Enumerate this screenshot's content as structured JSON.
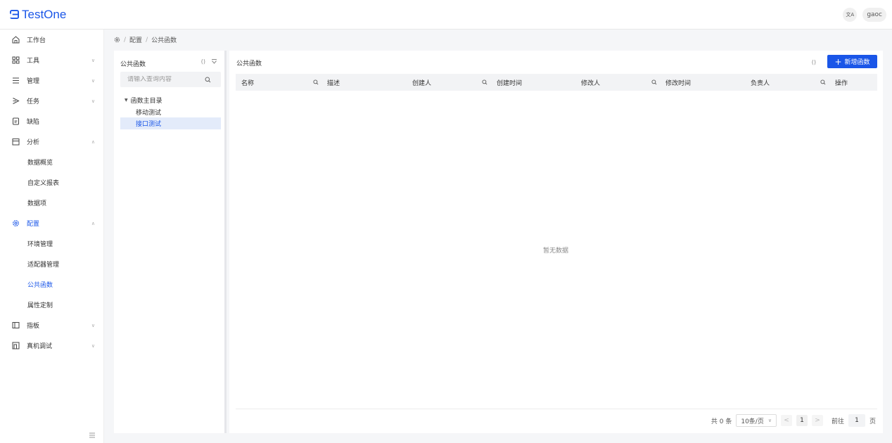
{
  "app": {
    "name": "TestOne",
    "brand_color": "#1a56e8"
  },
  "topbar": {
    "lang_icon": "translate-icon",
    "lang_label": "文A",
    "user": "gaoc"
  },
  "sidebar": {
    "items": [
      {
        "label": "工作台",
        "icon": "home-icon"
      },
      {
        "label": "工具",
        "icon": "grid-icon",
        "arrow": "∨"
      },
      {
        "label": "管理",
        "icon": "list-icon",
        "arrow": "∨"
      },
      {
        "label": "任务",
        "icon": "play-icon",
        "arrow": "∨"
      },
      {
        "label": "缺陷",
        "icon": "doc-icon"
      },
      {
        "label": "分析",
        "icon": "calendar-icon",
        "arrow": "∧"
      },
      {
        "label": "数据概览"
      },
      {
        "label": "自定义报表"
      },
      {
        "label": "数据项"
      },
      {
        "label": "配置",
        "icon": "gear-icon",
        "arrow": "∧"
      },
      {
        "label": "环境管理"
      },
      {
        "label": "适配器管理"
      },
      {
        "label": "公共函数"
      },
      {
        "label": "属性定制"
      },
      {
        "label": "指板",
        "icon": "board-icon",
        "arrow": "∨"
      },
      {
        "label": "真机调试",
        "icon": "device-icon",
        "arrow": "∨"
      }
    ]
  },
  "breadcrumb": {
    "home_icon": "settings-icon",
    "items": [
      "配置",
      "公共函数"
    ],
    "separator": "/"
  },
  "tree": {
    "title": "公共函数",
    "refresh_icon": "()",
    "search_placeholder": "请输入查询内容",
    "root": "函数主目录",
    "nodes": [
      "移动测试",
      "接口测试"
    ],
    "selected": "接口测试"
  },
  "main": {
    "title": "公共函数",
    "refresh_icon": "()",
    "add_button": "新增函数",
    "columns": [
      "名称",
      "描述",
      "创建人",
      "创建时间",
      "修改人",
      "修改时间",
      "负责人",
      "操作"
    ],
    "empty_text": "暂无数据"
  },
  "pager": {
    "total_text": "共 0 条",
    "page_size": "10条/页",
    "prev": "<",
    "current_page": "1",
    "next": ">",
    "goto_label": "前往",
    "goto_value": "1",
    "page_unit": "页"
  }
}
